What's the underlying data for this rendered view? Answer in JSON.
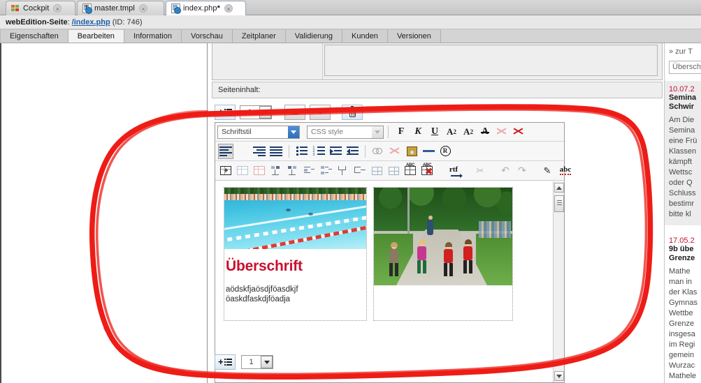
{
  "app_tabs": [
    {
      "label": "Cockpit",
      "icon": "cockpit-icon",
      "modified": false,
      "active": false
    },
    {
      "label": "master.tmpl",
      "icon": "template-doc-icon",
      "modified": false,
      "active": false
    },
    {
      "label": "index.php",
      "icon": "php-doc-icon",
      "modified": true,
      "active": true
    }
  ],
  "close_glyph": "×",
  "page_header": {
    "label": "webEdition-Seite",
    "colon": ":",
    "link": "/index.php",
    "id_text": "(ID: 746)"
  },
  "section_tabs": [
    {
      "label": "Eigenschaften",
      "active": false
    },
    {
      "label": "Bearbeiten",
      "active": true
    },
    {
      "label": "Information",
      "active": false
    },
    {
      "label": "Vorschau",
      "active": false
    },
    {
      "label": "Zeitplaner",
      "active": false
    },
    {
      "label": "Validierung",
      "active": false
    },
    {
      "label": "Kunden",
      "active": false
    },
    {
      "label": "Versionen",
      "active": false
    }
  ],
  "content_label": "Seiteninhalt:",
  "block_toolbar_top": {
    "add_label": "add-block",
    "count_value": "1",
    "move_up_label": "move-up",
    "move_down_label": "move-down",
    "delete_label": "delete-block"
  },
  "block_toolbar_bottom": {
    "add_label": "add-block",
    "count_value": "1"
  },
  "editor": {
    "font_style_select": {
      "value": "Schriftstil"
    },
    "css_style_select": {
      "value": "CSS style"
    },
    "format_buttons": [
      {
        "name": "bold-button",
        "glyph": "F",
        "title": "Fett"
      },
      {
        "name": "italic-button",
        "glyph": "K",
        "title": "Kursiv"
      },
      {
        "name": "underline-button",
        "glyph": "U",
        "title": "Unterstrichen"
      },
      {
        "name": "subscript-button",
        "glyph": "A",
        "sub": "2"
      },
      {
        "name": "superscript-button",
        "glyph": "A",
        "sup": "2"
      },
      {
        "name": "strikethrough-button",
        "glyph": "A"
      }
    ],
    "paragraph_buttons": [
      "align-left-button",
      "align-center-button",
      "align-right-button",
      "align-justify-button",
      "bullet-list-button",
      "numbered-list-button",
      "indent-increase-button",
      "indent-decrease-button",
      "insert-link-button",
      "remove-link-button",
      "insert-image-button",
      "horizontal-rule-button",
      "special-character-button"
    ],
    "table_buttons": [
      "insert-table-button",
      "table-properties-button",
      "cell-properties-button",
      "insert-row-above-button",
      "insert-row-below-button",
      "insert-column-left-button",
      "insert-column-right-button",
      "merge-cells-button",
      "split-cell-button",
      "insert-table-grid-button",
      "delete-table-grid-button",
      "table-text-button",
      "delete-table-button",
      "rtf-paste-button",
      "cut-button",
      "undo-button",
      "redo-button",
      "edit-source-button",
      "spellcheck-button"
    ],
    "rtf_label": "rtf",
    "spell_label": "abc",
    "register_glyph": "R",
    "content": {
      "heading": "Überschrift",
      "paragraph": "aödskfjaösdjföasdkjf öaskdfaskdjföadja",
      "image_left_alt": "Freibad-Schwimmbecken mit Schwimmbahnen",
      "image_right_alt": "Vier laufende Mädchen auf einem Weg"
    }
  },
  "right_panel": {
    "top_link": "» zur T",
    "search_value": "Übersch",
    "news": [
      {
        "date": "10.07.2",
        "title_lines": [
          "Semina",
          "Schwir"
        ],
        "body_lines": [
          "Am Die",
          "Semina",
          "eine Frü",
          "Klassen",
          "kämpft",
          "Wettsc",
          "oder Q",
          "Schluss",
          "bestimr",
          "bitte kl"
        ]
      },
      {
        "date": "17.05.2",
        "title_lines": [
          "9b übe",
          "Grenze"
        ],
        "body_lines": [
          "Mathe",
          "man in",
          "der Klas",
          "Gymnas",
          "Wettbe",
          "Grenze",
          "insgesa",
          "im Regi",
          "gemein",
          "Wurzac",
          "Mathele"
        ]
      }
    ]
  },
  "annotation": {
    "type": "hand-drawn-ellipse",
    "color": "#ee1c16",
    "purpose": "highlight-rich-text-editor-block"
  },
  "colors": {
    "accent_red": "#c8102e",
    "link_blue": "#1f5fa8",
    "annotation_red": "#ee1c16",
    "tab_active_bg": "#f2f2f2"
  }
}
